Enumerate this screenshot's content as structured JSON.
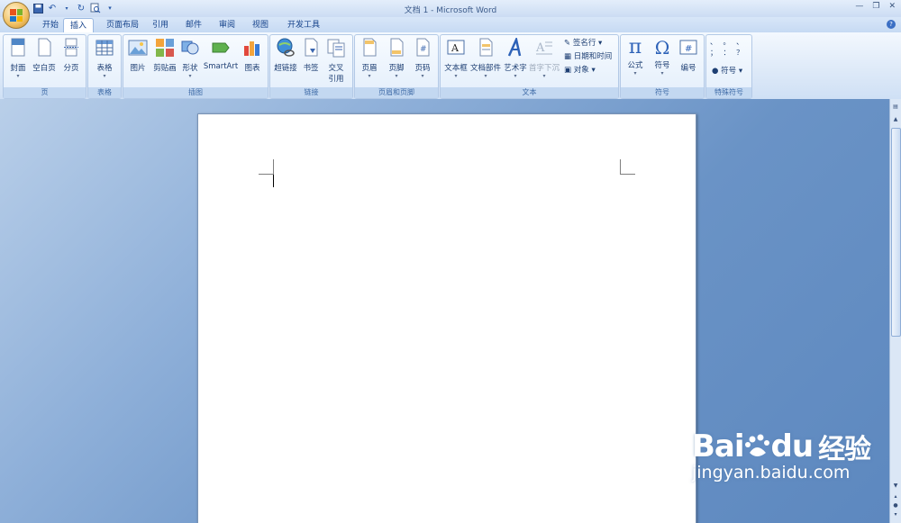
{
  "window": {
    "title": "文档 1 - Microsoft Word"
  },
  "tabs": [
    "开始",
    "插入",
    "页面布局",
    "引用",
    "邮件",
    "审阅",
    "视图",
    "开发工具"
  ],
  "active_tab": "插入",
  "groups": {
    "pages": {
      "label": "页",
      "buttons": [
        "封面",
        "空白页",
        "分页"
      ]
    },
    "tables": {
      "label": "表格",
      "buttons": [
        "表格"
      ]
    },
    "illustrations": {
      "label": "插图",
      "buttons": [
        "图片",
        "剪贴画",
        "形状",
        "SmartArt",
        "图表"
      ]
    },
    "links": {
      "label": "链接",
      "buttons": [
        "超链接",
        "书签",
        "交叉\n引用"
      ],
      "cross_ref_line1": "交叉",
      "cross_ref_line2": "引用"
    },
    "header_footer": {
      "label": "页眉和页脚",
      "buttons": [
        "页眉",
        "页脚",
        "页码"
      ]
    },
    "text": {
      "label": "文本",
      "buttons": [
        "文本框",
        "文档部件",
        "艺术字",
        "首字下沉"
      ],
      "small": [
        "签名行",
        "日期和时间",
        "对象"
      ]
    },
    "symbols": {
      "label": "符号",
      "buttons": [
        "公式",
        "符号",
        "编号"
      ]
    },
    "special": {
      "label": "特殊符号",
      "glyphs": "、 。 、 ； ： ？",
      "symbol_btn": "符号"
    }
  },
  "watermark": {
    "brand": "Bai",
    "brand2": "du",
    "cn": "经验",
    "url": "jingyan.baidu.com"
  },
  "colors": {
    "ribbon_bg": "#dde9f8",
    "workspace": "#6a93c6",
    "accent": "#15428b"
  }
}
